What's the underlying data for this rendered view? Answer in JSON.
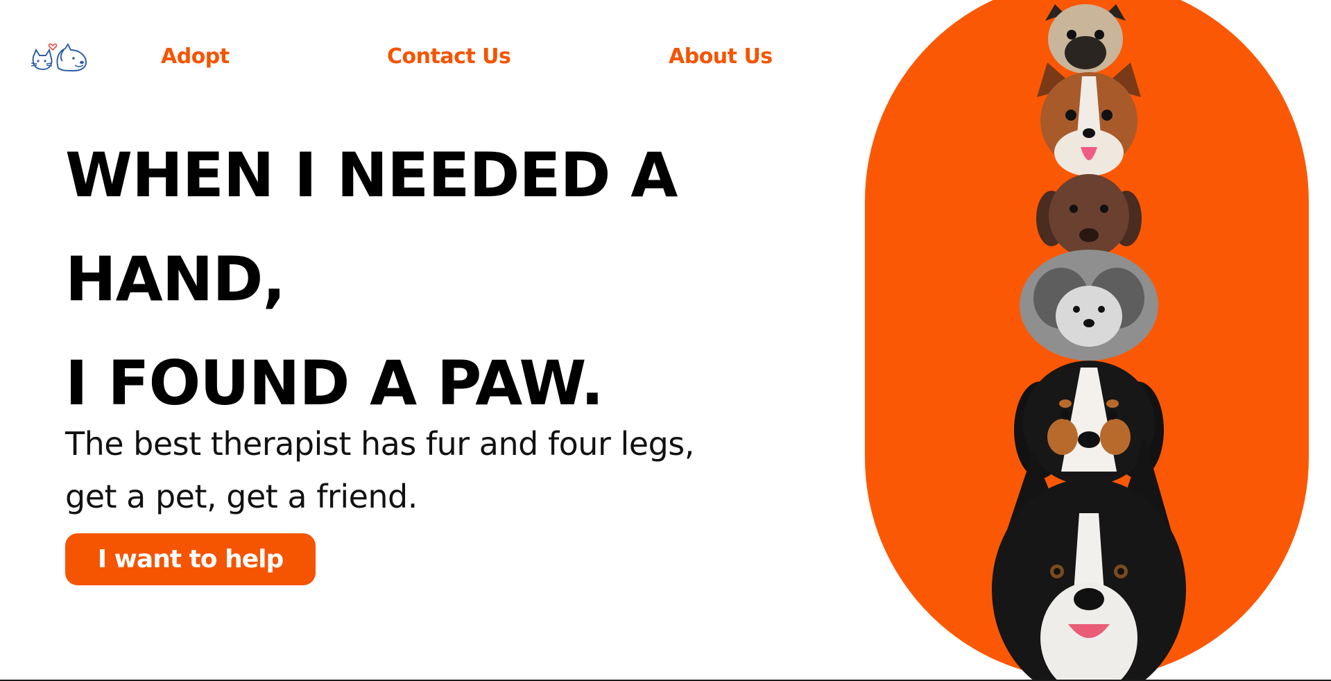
{
  "nav": {
    "adopt": "Adopt",
    "contact": "Contact Us",
    "about": "About Us"
  },
  "hero": {
    "headline_lines": [
      "WHEN I NEEDED A",
      "HAND,",
      "I FOUND A PAW."
    ],
    "tagline_lines": [
      "The best therapist has fur and four legs,",
      "get a pet, get a friend."
    ],
    "cta_label": "I want to help"
  },
  "icons": {
    "logo": "cat-and-dog-logo-icon",
    "heart": "heart-icon"
  },
  "colors": {
    "accent": "#f55400",
    "pill_background": "#fb5806",
    "text": "#000000"
  }
}
